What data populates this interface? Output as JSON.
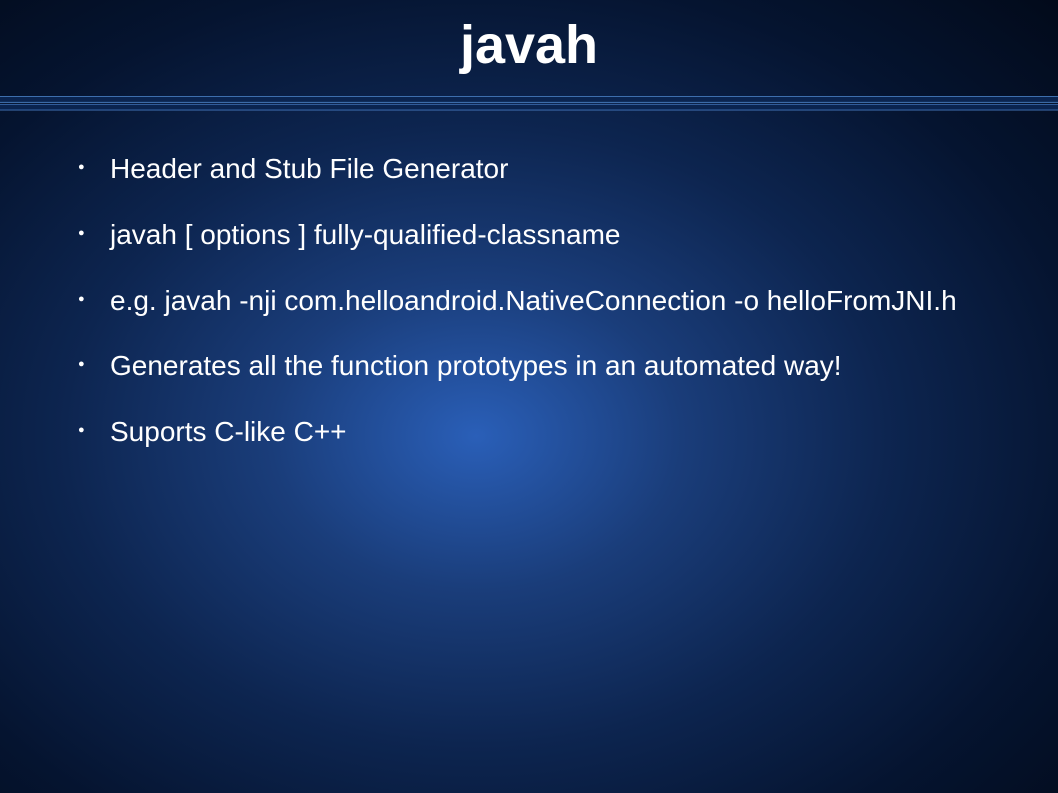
{
  "title": "javah",
  "bullets": [
    " Header and Stub File Generator",
    "javah [ options ] fully-qualified-classname",
    "e.g. javah -nji com.helloandroid.NativeConnection -o helloFromJNI.h",
    "Generates all the function prototypes in an automated way!",
    "Suports C-like C++"
  ]
}
